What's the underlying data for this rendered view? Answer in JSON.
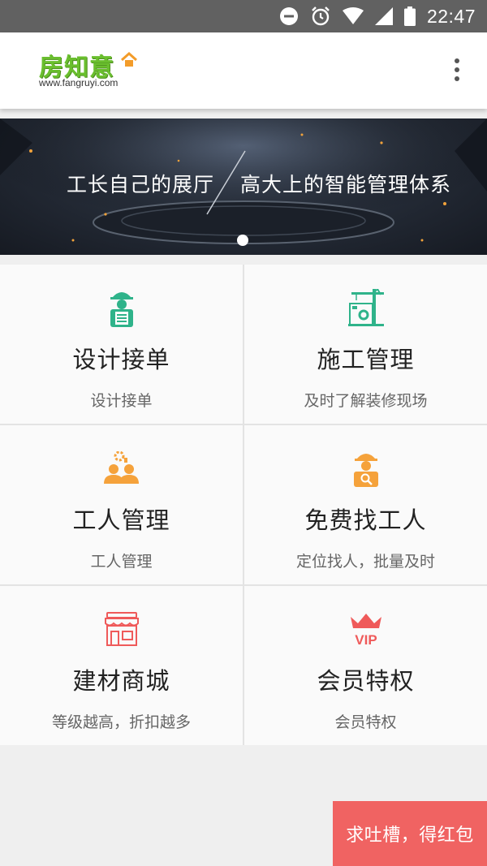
{
  "status_bar": {
    "time": "22:47"
  },
  "header": {
    "logo_text": "房知意",
    "logo_url": "www.fangruyi.com"
  },
  "banner": {
    "left_text": "工长自己的展厅",
    "right_text": "高大上的智能管理体系"
  },
  "tiles": [
    {
      "title": "设计接单",
      "subtitle": "设计接单",
      "icon": "blueprint-worker-icon",
      "color": "#2fb38a"
    },
    {
      "title": "施工管理",
      "subtitle": "及时了解装修现场",
      "icon": "crane-icon",
      "color": "#2fb38a"
    },
    {
      "title": "工人管理",
      "subtitle": "工人管理",
      "icon": "workers-gear-icon",
      "color": "#f5a23b"
    },
    {
      "title": "免费找工人",
      "subtitle": "定位找人，批量及时",
      "icon": "worker-search-icon",
      "color": "#f5a23b"
    },
    {
      "title": "建材商城",
      "subtitle": "等级越高，折扣越多",
      "icon": "store-icon",
      "color": "#ef5a5a"
    },
    {
      "title": "会员特权",
      "subtitle": "会员特权",
      "icon": "vip-crown-icon",
      "color": "#ef5a5a"
    }
  ],
  "feedback": {
    "label": "求吐槽，得红包"
  }
}
